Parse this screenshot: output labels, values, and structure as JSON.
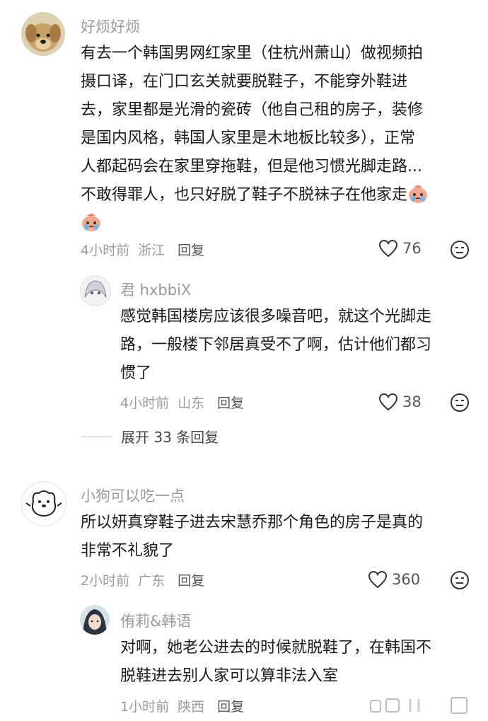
{
  "comments": [
    {
      "username": "好烦好烦",
      "text_a": "有去一个韩国男网红家里（住杭州萧山）做视频拍",
      "text_b": "摄口译，在门口玄关就要脱鞋子，不能穿外鞋进",
      "text_c": "去，家里都是光滑的瓷砖（他自己租的房子，装修",
      "text_d": "是国内风格，韩国人家里是木地板比较多），正常",
      "text_e": "人都起码会在家里穿拖鞋，但是他习惯光脚走路...",
      "text_f": "不敢得罪人，也只好脱了鞋子不脱袜子在他家走",
      "time": "4小时前",
      "location": "浙江",
      "reply_label": "回复",
      "likes": "76"
    },
    {
      "username": "君 hxbbiX",
      "text_a": "感觉韩国楼房应该很多噪音吧，就这个光脚走",
      "text_b": "路，一般楼下邻居真受不了啊，估计他们都习",
      "text_c": "惯了",
      "time": "4小时前",
      "location": "山东",
      "reply_label": "回复",
      "likes": "38",
      "expand_label": "展开 33 条回复"
    },
    {
      "username": "小狗可以吃一点",
      "text_a": "所以妍真穿鞋子进去宋慧乔那个角色的房子是真的",
      "text_b": "非常不礼貌了",
      "time": "2小时前",
      "location": "广东",
      "reply_label": "回复",
      "likes": "360"
    },
    {
      "username": "侑莉&韩语",
      "text_a": "对啊，她老公进去的时候就脱鞋了，在韩国不",
      "text_b": "脱鞋进去别人家可以算非法入室",
      "time": "1小时前",
      "location": "陕西",
      "reply_label": "回复"
    }
  ],
  "colors": {
    "meta": "#9a9a9a",
    "text": "#1a1a1a",
    "icon": "#333333"
  }
}
